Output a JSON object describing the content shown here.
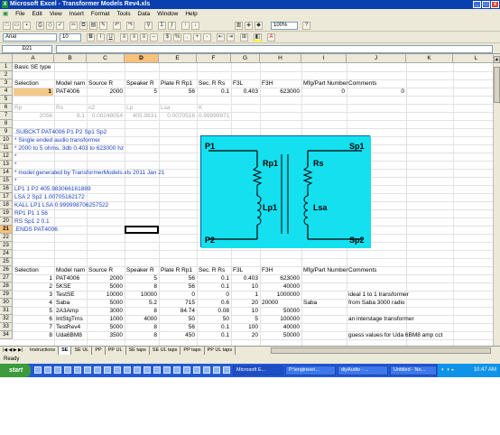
{
  "window": {
    "title": "Microsoft Excel - Transformer Models Rev4.xls"
  },
  "menu": [
    "File",
    "Edit",
    "View",
    "Insert",
    "Format",
    "Tools",
    "Data",
    "Window",
    "Help"
  ],
  "toolbar": {
    "zoom": "100%",
    "font": "Arial",
    "size": "10"
  },
  "formula": {
    "name_box": "D21",
    "content": ""
  },
  "columns": [
    "A",
    "B",
    "C",
    "D",
    "E",
    "F",
    "G",
    "H",
    "I",
    "J",
    "K",
    "L",
    "M"
  ],
  "rows": [
    {
      "n": "1",
      "cells": [
        {
          "c": "A",
          "v": "Basic SE type"
        }
      ]
    },
    {
      "n": "2",
      "cells": []
    },
    {
      "n": "3",
      "cells": [
        {
          "c": "A",
          "v": "Selection"
        },
        {
          "c": "B",
          "v": "Model nam"
        },
        {
          "c": "C",
          "v": "Source R"
        },
        {
          "c": "D",
          "v": "Speaker R"
        },
        {
          "c": "E",
          "v": "Plate R Rp1"
        },
        {
          "c": "F",
          "v": "Sec. R Rs"
        },
        {
          "c": "G",
          "v": "F3L"
        },
        {
          "c": "H",
          "v": "F3H"
        },
        {
          "c": "I",
          "v": "Mfg/Part Number"
        },
        {
          "c": "J",
          "v": "Comments"
        }
      ]
    },
    {
      "n": "4",
      "cells": [
        {
          "c": "A",
          "v": "1",
          "r": true,
          "hl": true
        },
        {
          "c": "B",
          "v": "PAT4006"
        },
        {
          "c": "C",
          "v": "2000",
          "r": true
        },
        {
          "c": "D",
          "v": "5",
          "r": true
        },
        {
          "c": "E",
          "v": "56",
          "r": true
        },
        {
          "c": "F",
          "v": "0.1",
          "r": true
        },
        {
          "c": "G",
          "v": "0.403",
          "r": true
        },
        {
          "c": "H",
          "v": "623000",
          "r": true
        },
        {
          "c": "I",
          "v": "0",
          "r": true
        },
        {
          "c": "J",
          "v": "0",
          "r": true
        }
      ]
    },
    {
      "n": "5",
      "cells": []
    },
    {
      "n": "6",
      "cells": [
        {
          "c": "A",
          "v": "Rp",
          "g": true
        },
        {
          "c": "B",
          "v": "Rs",
          "g": true
        },
        {
          "c": "C",
          "v": "n2",
          "g": true
        },
        {
          "c": "D",
          "v": "Lp",
          "g": true
        },
        {
          "c": "E",
          "v": "Lsa",
          "g": true
        },
        {
          "c": "F",
          "v": "K",
          "g": true
        }
      ]
    },
    {
      "n": "7",
      "cells": [
        {
          "c": "A",
          "v": "2056",
          "r": true,
          "g": true
        },
        {
          "c": "B",
          "v": "8.1",
          "r": true,
          "g": true
        },
        {
          "c": "C",
          "v": "0.00248054",
          "r": true,
          "g": true
        },
        {
          "c": "D",
          "v": "405.9831",
          "r": true,
          "g": true
        },
        {
          "c": "E",
          "v": "0.0070516",
          "r": true,
          "g": true
        },
        {
          "c": "F",
          "v": "0.99999971",
          "r": true,
          "g": true
        }
      ]
    },
    {
      "n": "8",
      "cells": []
    },
    {
      "n": "9",
      "cells": [
        {
          "c": "A",
          "v": " .SUBCKT PAT4006 P1 P2 Sp1 Sp2",
          "b": true
        }
      ]
    },
    {
      "n": "10",
      "cells": [
        {
          "c": "A",
          "v": "* Single ended audio transformer",
          "b": true
        }
      ]
    },
    {
      "n": "11",
      "cells": [
        {
          "c": "A",
          "v": "* 2000 to 5 ohms, 3db 0.403 to 623000 hz",
          "b": true
        }
      ]
    },
    {
      "n": "12",
      "cells": [
        {
          "c": "A",
          "v": "*",
          "b": true
        }
      ]
    },
    {
      "n": "13",
      "cells": [
        {
          "c": "A",
          "v": "*",
          "b": true
        }
      ]
    },
    {
      "n": "14",
      "cells": [
        {
          "c": "A",
          "v": "* model generated by TransformerModels.xls 2011 Jan 21",
          "b": true
        }
      ]
    },
    {
      "n": "15",
      "cells": [
        {
          "c": "A",
          "v": "*",
          "b": true
        }
      ]
    },
    {
      "n": "16",
      "cells": [
        {
          "c": "A",
          "v": "LP1 1 P2 405.983066161889",
          "b": true
        }
      ]
    },
    {
      "n": "17",
      "cells": [
        {
          "c": "A",
          "v": "LSA 2 Sp2 1.00705162172",
          "b": true
        }
      ]
    },
    {
      "n": "18",
      "cells": [
        {
          "c": "A",
          "v": "KALL LP1 LSA 0.999998706257522",
          "b": true
        }
      ]
    },
    {
      "n": "19",
      "cells": [
        {
          "c": "A",
          "v": "RP1 P1 1 56",
          "b": true
        }
      ]
    },
    {
      "n": "20",
      "cells": [
        {
          "c": "A",
          "v": "RS Sp1 2 0.1",
          "b": true
        }
      ]
    },
    {
      "n": "21",
      "cells": [
        {
          "c": "A",
          "v": ".ENDS PAT4006",
          "b": true
        }
      ]
    },
    {
      "n": "22",
      "cells": []
    },
    {
      "n": "23",
      "cells": []
    },
    {
      "n": "24",
      "cells": []
    },
    {
      "n": "25",
      "cells": []
    },
    {
      "n": "26",
      "cells": [
        {
          "c": "A",
          "v": "Selection"
        },
        {
          "c": "B",
          "v": "Model nam"
        },
        {
          "c": "C",
          "v": "Source R"
        },
        {
          "c": "D",
          "v": "Speaker R"
        },
        {
          "c": "E",
          "v": "Plate R Rp1"
        },
        {
          "c": "F",
          "v": "Sec. R Rs"
        },
        {
          "c": "G",
          "v": "F3L"
        },
        {
          "c": "H",
          "v": "F3H"
        },
        {
          "c": "I",
          "v": "Mfg/Part Number"
        },
        {
          "c": "J",
          "v": "Comments"
        }
      ]
    },
    {
      "n": "27",
      "cells": [
        {
          "c": "A",
          "v": "1",
          "r": true
        },
        {
          "c": "B",
          "v": "PAT4006"
        },
        {
          "c": "C",
          "v": "2000",
          "r": true
        },
        {
          "c": "D",
          "v": "5",
          "r": true
        },
        {
          "c": "E",
          "v": "56",
          "r": true
        },
        {
          "c": "F",
          "v": "0.1",
          "r": true
        },
        {
          "c": "G",
          "v": "0.403",
          "r": true
        },
        {
          "c": "H",
          "v": "623000",
          "r": true
        }
      ]
    },
    {
      "n": "28",
      "cells": [
        {
          "c": "A",
          "v": "2",
          "r": true
        },
        {
          "c": "B",
          "v": "5KSE"
        },
        {
          "c": "C",
          "v": "5000",
          "r": true
        },
        {
          "c": "D",
          "v": "8",
          "r": true
        },
        {
          "c": "E",
          "v": "56",
          "r": true
        },
        {
          "c": "F",
          "v": "0.1",
          "r": true
        },
        {
          "c": "G",
          "v": "10",
          "r": true
        },
        {
          "c": "H",
          "v": "40000",
          "r": true
        }
      ]
    },
    {
      "n": "29",
      "cells": [
        {
          "c": "A",
          "v": "3",
          "r": true
        },
        {
          "c": "B",
          "v": "TestSE"
        },
        {
          "c": "C",
          "v": "10000",
          "r": true
        },
        {
          "c": "D",
          "v": "10000",
          "r": true
        },
        {
          "c": "E",
          "v": "0",
          "r": true
        },
        {
          "c": "F",
          "v": "0",
          "r": true
        },
        {
          "c": "G",
          "v": "1",
          "r": true
        },
        {
          "c": "H",
          "v": "1000000",
          "r": true
        },
        {
          "c": "J",
          "v": "ideal 1 to 1 transformer"
        }
      ]
    },
    {
      "n": "30",
      "cells": [
        {
          "c": "A",
          "v": "4",
          "r": true
        },
        {
          "c": "B",
          "v": "Saba"
        },
        {
          "c": "C",
          "v": "5000",
          "r": true
        },
        {
          "c": "D",
          "v": "5.2",
          "r": true
        },
        {
          "c": "E",
          "v": "715",
          "r": true
        },
        {
          "c": "F",
          "v": "0.6",
          "r": true
        },
        {
          "c": "G",
          "v": "20",
          "r": true
        },
        {
          "c": "H",
          "v": "20000"
        },
        {
          "c": "I",
          "v": "Saba"
        },
        {
          "c": "J",
          "v": "from Saba  3000 radio"
        }
      ]
    },
    {
      "n": "31",
      "cells": [
        {
          "c": "A",
          "v": "5",
          "r": true
        },
        {
          "c": "B",
          "v": "2A3Amp"
        },
        {
          "c": "C",
          "v": "3000",
          "r": true
        },
        {
          "c": "D",
          "v": "8",
          "r": true
        },
        {
          "c": "E",
          "v": "84.74",
          "r": true
        },
        {
          "c": "F",
          "v": "0.08",
          "r": true
        },
        {
          "c": "G",
          "v": "10",
          "r": true
        },
        {
          "c": "H",
          "v": "50000",
          "r": true
        }
      ]
    },
    {
      "n": "32",
      "cells": [
        {
          "c": "A",
          "v": "6",
          "r": true
        },
        {
          "c": "B",
          "v": "IntStgTrns"
        },
        {
          "c": "C",
          "v": "1000",
          "r": true
        },
        {
          "c": "D",
          "v": "4000",
          "r": true
        },
        {
          "c": "E",
          "v": "50",
          "r": true
        },
        {
          "c": "F",
          "v": "50",
          "r": true
        },
        {
          "c": "G",
          "v": "5",
          "r": true
        },
        {
          "c": "H",
          "v": "100000",
          "r": true
        },
        {
          "c": "J",
          "v": "an interstage transformer"
        }
      ]
    },
    {
      "n": "33",
      "cells": [
        {
          "c": "A",
          "v": "7",
          "r": true
        },
        {
          "c": "B",
          "v": "TestRev4"
        },
        {
          "c": "C",
          "v": "5000",
          "r": true
        },
        {
          "c": "D",
          "v": "8",
          "r": true
        },
        {
          "c": "E",
          "v": "56",
          "r": true
        },
        {
          "c": "F",
          "v": "0.1",
          "r": true
        },
        {
          "c": "G",
          "v": "100",
          "r": true
        },
        {
          "c": "H",
          "v": "40000",
          "r": true
        }
      ]
    },
    {
      "n": "34",
      "cells": [
        {
          "c": "A",
          "v": "8",
          "r": true
        },
        {
          "c": "B",
          "v": "Uda6BM8"
        },
        {
          "c": "C",
          "v": "3500",
          "r": true
        },
        {
          "c": "D",
          "v": "8",
          "r": true
        },
        {
          "c": "E",
          "v": "450",
          "r": true
        },
        {
          "c": "F",
          "v": "0.1",
          "r": true
        },
        {
          "c": "G",
          "v": "20",
          "r": true
        },
        {
          "c": "H",
          "v": "50000",
          "r": true
        },
        {
          "c": "J",
          "v": "guess values for Uda 6BM8 amp cct"
        }
      ]
    }
  ],
  "schematic": {
    "p1": "P1",
    "p2": "P2",
    "sp1": "Sp1",
    "sp2": "Sp2",
    "rp1": "Rp1",
    "lp1": "Lp1",
    "rs": "Rs",
    "lsa": "Lsa",
    "bg": "#14e0ef"
  },
  "sheet_tabs": [
    "Instructions",
    "SE UL",
    "PP",
    "PP UL",
    "SE taps",
    "SE UL taps",
    "PP taps",
    "PP UL taps"
  ],
  "active_tab": "SE",
  "status": "Ready",
  "taskbar": {
    "start": "start",
    "buttons": [
      "Microsoft E...",
      "P:\\engineeri...",
      "diyAudio - ...",
      "Untitled - No..."
    ],
    "clock": "10:47 AM"
  }
}
